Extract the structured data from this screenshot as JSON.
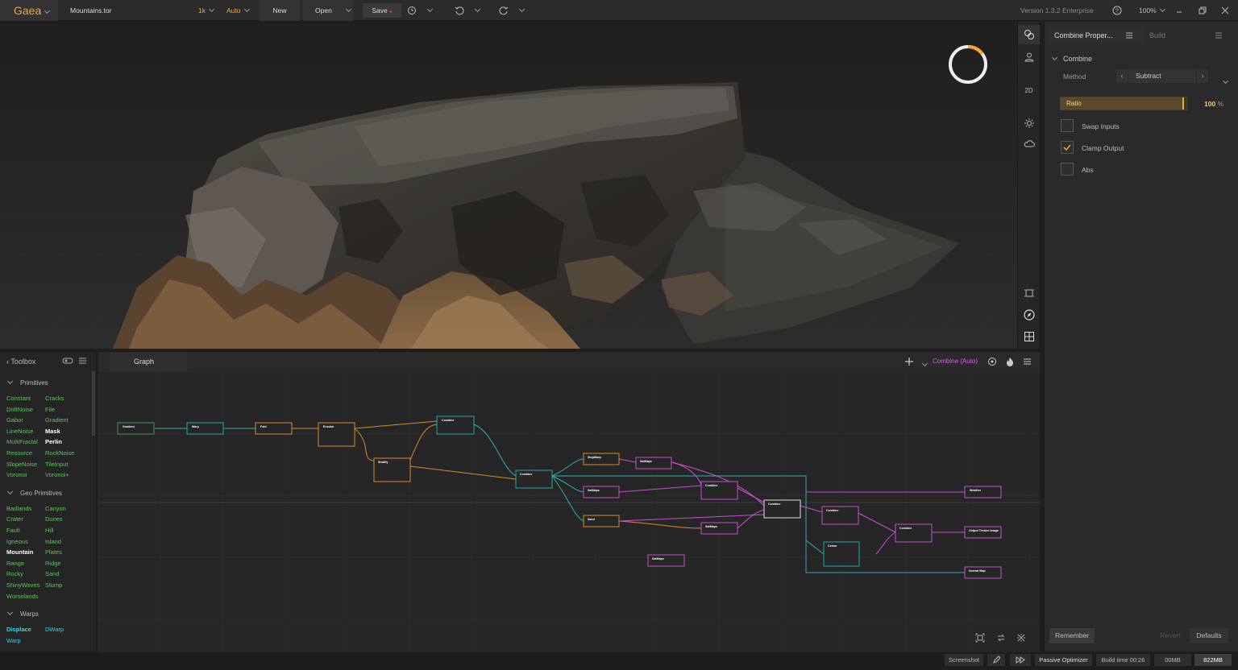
{
  "app": {
    "name": "Gaea",
    "filename": "Mountains.tor",
    "resolution": "1k",
    "build_mode": "Auto",
    "version": "Version 1.3.2 Enterprise",
    "zoom": "100%"
  },
  "toolbar": {
    "new_label": "New",
    "open_label": "Open",
    "save_label": "Save",
    "save_dot": "●"
  },
  "viewport_tools": {
    "view_2d": "2D"
  },
  "properties": {
    "tab_active": "Combine Proper...",
    "tab_build": "Build",
    "section": "Combine",
    "method_label": "Method",
    "method_value": "Subtract",
    "ratio_label": "Ratio",
    "ratio_value": "100",
    "ratio_unit": "%",
    "ratio_fraction": 0.98,
    "checkboxes": [
      {
        "label": "Swap Inputs",
        "checked": false
      },
      {
        "label": "Clamp Output",
        "checked": true
      },
      {
        "label": "Abs",
        "checked": false
      }
    ],
    "remember_label": "Remember",
    "revert_label": "Revert",
    "defaults_label": "Defaults"
  },
  "toolbox": {
    "title": "Toolbox",
    "sections": [
      {
        "name": "Primitives",
        "col1": [
          "Constant",
          "DriftNoise",
          "Gabor",
          "LineNoise",
          "MultiFractal",
          "Resource",
          "SlopeNoise",
          "Voronoi"
        ],
        "col2": [
          "Cracks",
          "File",
          "Gradient",
          "Mask",
          "Perlin",
          "RockNoise",
          "TileInput",
          "Voronoi+"
        ]
      },
      {
        "name": "Geo Primitives",
        "col1": [
          "Badlands",
          "Crater",
          "Fault",
          "Igneous",
          "Mountain",
          "Range",
          "Rocky",
          "ShinyWaves",
          "Worselands"
        ],
        "col2": [
          "Canyon",
          "Dunes",
          "Hill",
          "Island",
          "Plates",
          "Ridge",
          "Sand",
          "Slump"
        ]
      },
      {
        "name": "Warps",
        "col1": [
          "Displace",
          "Warp"
        ],
        "col2": [
          "DWarp"
        ]
      }
    ]
  },
  "graph": {
    "tab_label": "Graph",
    "active_node": "Combine (Auto)",
    "nodes": [
      "Gradient",
      "Warp",
      "Fold",
      "Erosion",
      "Combine",
      "Stratify",
      "Combine",
      "SlopWarp",
      "SatMaps",
      "SatMaps",
      "Combine",
      "Combine",
      "Combine",
      "Sand",
      "SatMaps",
      "Combine",
      "Colour",
      "Combine",
      "SatMaps",
      "Weather",
      "Output Texture Image",
      "Normal Map"
    ]
  },
  "status": {
    "screenshot_label": "Screenshot",
    "optimizer_label": "Passive Optimizer",
    "build_time": "Build time 00:26",
    "memory1": "00MB",
    "memory2": "822MB"
  },
  "colors": {
    "accent": "#f0a838",
    "green": "#5ec35e",
    "cyan": "#27b9c6",
    "magenta": "#c64fd1",
    "orange_node": "#d5892b",
    "teal_node": "#22a8a6"
  }
}
